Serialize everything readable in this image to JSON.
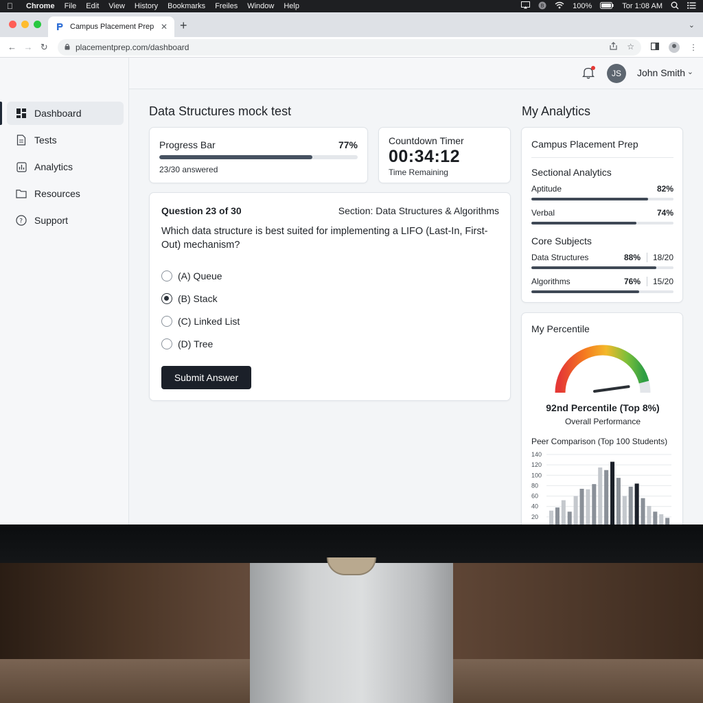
{
  "menubar": {
    "app": "Chrome",
    "items": [
      "File",
      "Edit",
      "View",
      "History",
      "Bookmarks",
      "Freiles",
      "Window",
      "Help"
    ],
    "battery": "100%",
    "clock": "Tor 1:08 AM"
  },
  "browser": {
    "tab_title": "Campus Placement Prep",
    "url": "placementprep.com/dashboard"
  },
  "sidebar": {
    "items": [
      {
        "label": "Dashboard",
        "icon": "dashboard-icon",
        "active": true
      },
      {
        "label": "Tests",
        "icon": "document-icon",
        "active": false
      },
      {
        "label": "Analytics",
        "icon": "chart-icon",
        "active": false
      },
      {
        "label": "Resources",
        "icon": "folder-icon",
        "active": false
      },
      {
        "label": "Support",
        "icon": "help-icon",
        "active": false
      }
    ]
  },
  "topbar": {
    "avatar_initials": "JS",
    "user_name": "John Smith"
  },
  "main": {
    "title": "Data Structures mock test",
    "progress": {
      "label": "Progress Bar",
      "percent_text": "77%",
      "fraction": 0.77,
      "answered": "23/30 answered"
    },
    "timer": {
      "label": "Countdown Timer",
      "time": "00:34:12",
      "sub": "Time Remaining"
    },
    "question": {
      "number": "Question 23 of 30",
      "section": "Section: Data Structures & Algorithms",
      "text": "Which data structure is best suited for implementing a LIFO (Last-In, First-Out) mechanism?",
      "options": [
        {
          "label": "(A) Queue",
          "selected": false
        },
        {
          "label": "(B) Stack",
          "selected": true
        },
        {
          "label": "(C) Linked List",
          "selected": false
        },
        {
          "label": "(D) Tree",
          "selected": false
        }
      ],
      "submit_label": "Submit Answer"
    }
  },
  "analytics": {
    "title": "My Analytics",
    "card_title": "Campus Placement Prep",
    "sectional_title": "Sectional Analytics",
    "sectional": [
      {
        "label": "Aptitude",
        "percent_text": "82%",
        "fraction": 0.82
      },
      {
        "label": "Verbal",
        "percent_text": "74%",
        "fraction": 0.74
      }
    ],
    "core_title": "Core Subjects",
    "core": [
      {
        "label": "Data Structures",
        "percent_text": "88%",
        "count": "18/20",
        "fraction": 0.88
      },
      {
        "label": "Algorithms",
        "percent_text": "76%",
        "count": "15/20",
        "fraction": 0.76
      }
    ]
  },
  "percentile": {
    "title": "My Percentile",
    "value_text": "92nd Percentile (Top 8%)",
    "sub": "Overall Performance",
    "gauge_fraction": 0.92,
    "peer_title": "Peer Comparison (Top 100 Students)"
  },
  "chart_data": {
    "type": "bar",
    "title": "Peer Comparison (Top 100 Students)",
    "y_ticks": [
      20,
      40,
      60,
      80,
      100,
      120,
      140
    ],
    "ylim": [
      0,
      140
    ],
    "values": [
      32,
      38,
      52,
      30,
      60,
      74,
      73,
      83,
      115,
      110,
      126,
      95,
      60,
      78,
      84,
      56,
      41,
      30,
      25,
      18
    ],
    "highlight_index": 10,
    "secondary_highlight_index": 14,
    "colors": {
      "light": "#c4c8cd",
      "mid": "#8a9098",
      "dark": "#1b2029"
    }
  }
}
